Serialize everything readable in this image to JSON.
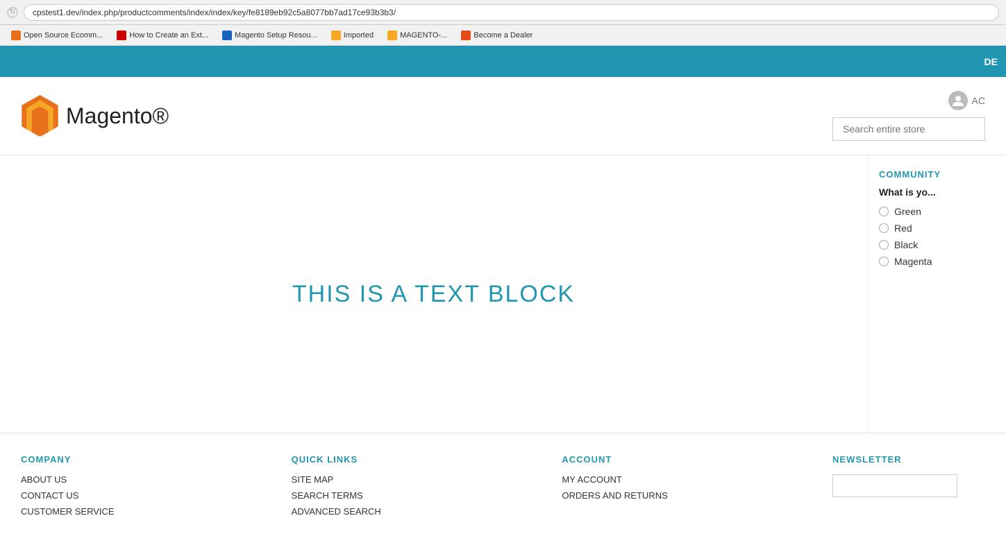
{
  "browser": {
    "url": "cpstest1.dev/index.php/productcomments/index/index/key/fe8189eb92c5a8077bb7ad17ce93b3b3/",
    "spinner_icon": "↻"
  },
  "bookmarks": [
    {
      "label": "Open Source Ecomm...",
      "fav_class": "fav-orange"
    },
    {
      "label": "How to Create an Ext...",
      "fav_class": "fav-red"
    },
    {
      "label": "Magento Setup Resou...",
      "fav_class": "fav-blue"
    },
    {
      "label": "Imported",
      "fav_class": "fav-yellow"
    },
    {
      "label": "MAGENTO-...",
      "fav_class": "fav-yellow"
    },
    {
      "label": "Become a Dealer",
      "fav_class": "fav-orange2"
    }
  ],
  "topbar": {
    "text": "DE"
  },
  "header": {
    "logo_text": "Magento®",
    "account_label": "AC",
    "search_placeholder": "Search entire store"
  },
  "main": {
    "text_block": "THIS IS A TEXT BLOCK"
  },
  "sidebar": {
    "section_title": "COMMUNITY",
    "question": "What is yo...",
    "options": [
      {
        "label": "Green"
      },
      {
        "label": "Red"
      },
      {
        "label": "Black"
      },
      {
        "label": "Magenta"
      }
    ]
  },
  "footer": {
    "columns": [
      {
        "title": "COMPANY",
        "links": [
          "ABOUT US",
          "CONTACT US",
          "CUSTOMER SERVICE"
        ]
      },
      {
        "title": "QUICK LINKS",
        "links": [
          "SITE MAP",
          "SEARCH TERMS",
          "ADVANCED SEARCH"
        ]
      },
      {
        "title": "ACCOUNT",
        "links": [
          "MY ACCOUNT",
          "ORDERS AND RETURNS"
        ]
      }
    ],
    "newsletter": {
      "title": "NEWSLETTER",
      "input_placeholder": ""
    }
  }
}
